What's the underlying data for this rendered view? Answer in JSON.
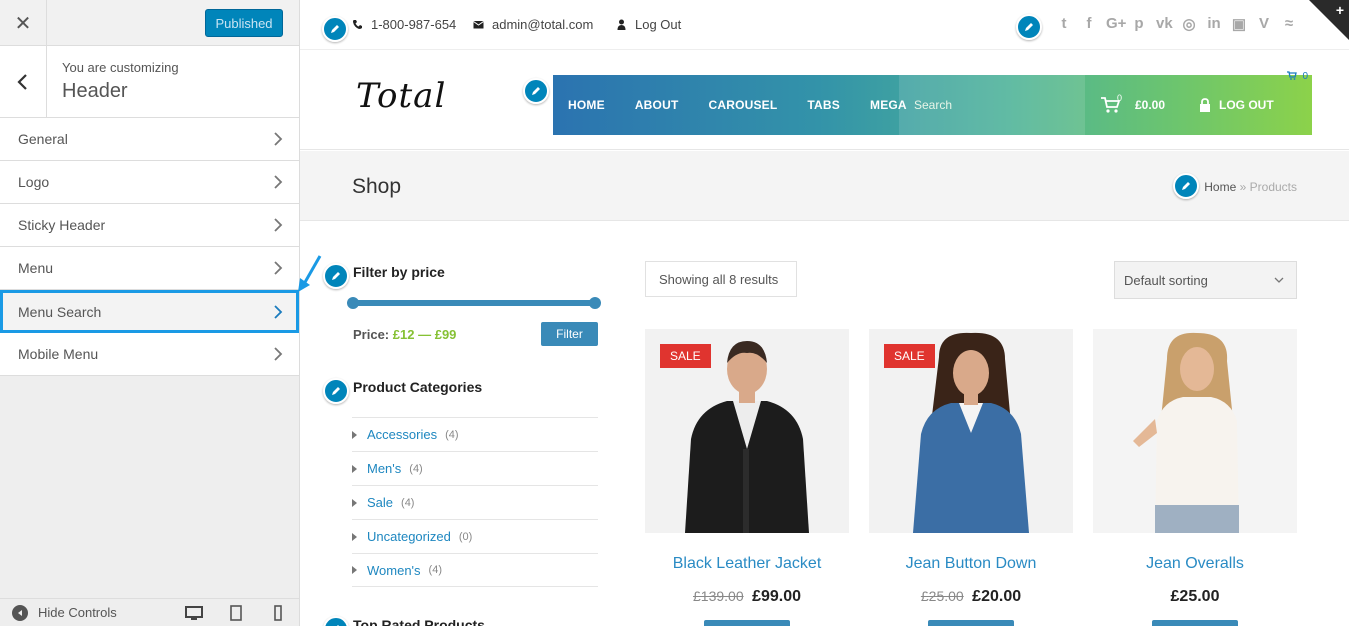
{
  "customizer": {
    "publish_label": "Published",
    "context_small": "You are customizing",
    "context_title": "Header",
    "items": [
      {
        "label": "General"
      },
      {
        "label": "Logo"
      },
      {
        "label": "Sticky Header"
      },
      {
        "label": "Menu"
      },
      {
        "label": "Menu Search"
      },
      {
        "label": "Mobile Menu"
      }
    ],
    "active_item": "Menu Search",
    "hide_controls_label": "Hide Controls",
    "accent_color": "#0085ba",
    "highlight_color": "#1a9ae5"
  },
  "topbar": {
    "phone": "1-800-987-654",
    "email": "admin@total.com",
    "logout": "Log Out",
    "social_icons": [
      "twitter-icon",
      "facebook-icon",
      "google-plus-icon",
      "pinterest-icon",
      "vk-icon",
      "instagram-icon",
      "linkedin-icon",
      "flickr-icon",
      "vimeo-icon",
      "rss-icon"
    ]
  },
  "header": {
    "logo_text": "Total",
    "nav": [
      "HOME",
      "ABOUT",
      "CAROUSEL",
      "TABS",
      "MEGA"
    ],
    "search_placeholder": "Search",
    "cart_count": "0",
    "cart_total": "£0.00",
    "logout": "LOG OUT",
    "mini_cart_count": "0"
  },
  "titlebar": {
    "title": "Shop",
    "breadcrumb_home": "Home",
    "breadcrumb_sep": "»",
    "breadcrumb_current": "Products"
  },
  "sidebar": {
    "filter_title": "Filter by price",
    "price_prefix": "Price:",
    "price_min": "£12",
    "price_dash": "—",
    "price_max": "£99",
    "filter_button": "Filter",
    "categories_title": "Product Categories",
    "categories": [
      {
        "name": "Accessories",
        "count": "(4)"
      },
      {
        "name": "Men's",
        "count": "(4)"
      },
      {
        "name": "Sale",
        "count": "(4)"
      },
      {
        "name": "Uncategorized",
        "count": "(0)"
      },
      {
        "name": "Women's",
        "count": "(4)"
      }
    ],
    "next_title_partial": "Top Rated Products"
  },
  "shop": {
    "result_count": "Showing all 8 results",
    "sorting_selected": "Default sorting",
    "products": [
      {
        "name": "Black Leather Jacket",
        "old_price": "£139.00",
        "price": "£99.00",
        "sale_label": "SALE"
      },
      {
        "name": "Jean Button Down",
        "old_price": "£25.00",
        "price": "£20.00",
        "sale_label": "SALE"
      },
      {
        "name": "Jean Overalls",
        "old_price": "",
        "price": "£25.00",
        "sale_label": ""
      }
    ]
  }
}
